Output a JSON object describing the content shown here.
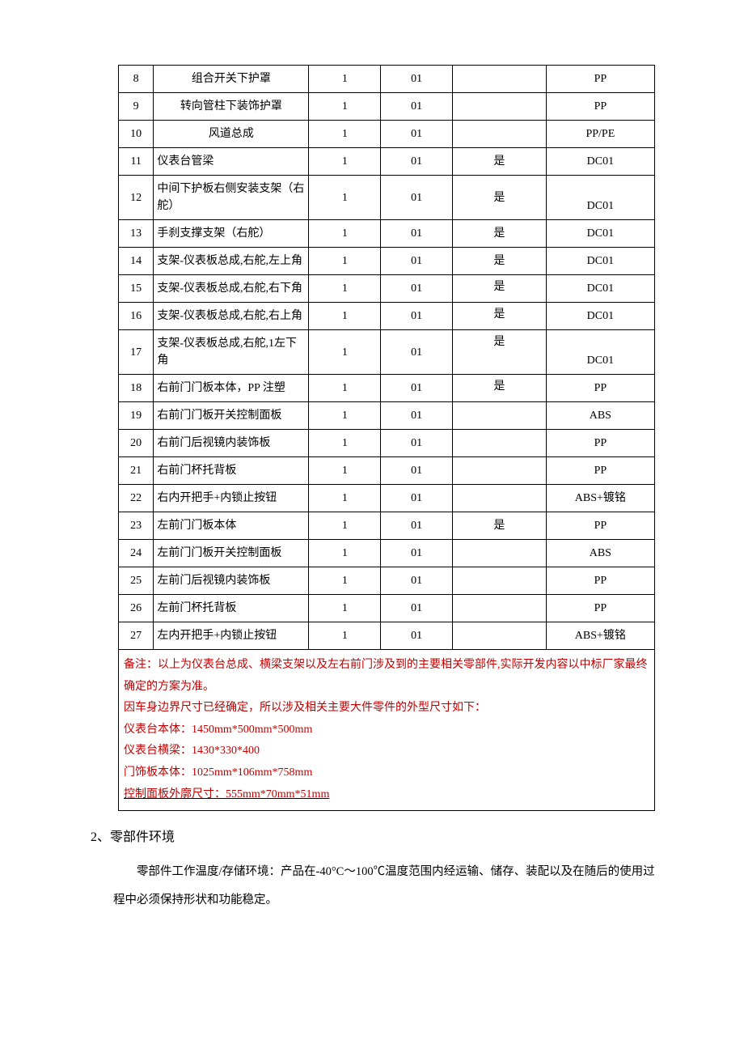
{
  "rows": [
    {
      "n": "8",
      "name": "组合开关下护罩",
      "nameClass": "center",
      "qty": "1",
      "code": "01",
      "flag": "",
      "mat": "PP"
    },
    {
      "n": "9",
      "name": "转向管柱下装饰护罩",
      "nameClass": "center",
      "qty": "1",
      "code": "01",
      "flag": "",
      "mat": "PP"
    },
    {
      "n": "10",
      "name": "风道总成",
      "nameClass": "center",
      "qty": "1",
      "code": "01",
      "flag": "",
      "mat": "PP/PE"
    },
    {
      "n": "11",
      "name": "仪表台管梁",
      "nameClass": "",
      "qty": "1",
      "code": "01",
      "flag": "是",
      "mat": "DC01"
    },
    {
      "n": "12",
      "name": "中间下护板右侧安装支架（右舵）",
      "nameClass": "",
      "qty": "1",
      "code": "01",
      "flag": "是",
      "mat": "DC01",
      "matBottom": true
    },
    {
      "n": "13",
      "name": "手刹支撑支架（右舵）",
      "nameClass": "",
      "qty": "1",
      "code": "01",
      "flag": "是",
      "mat": "DC01"
    },
    {
      "n": "14",
      "name": "支架-仪表板总成,右舵,左上角",
      "nameClass": "",
      "qty": "1",
      "code": "01",
      "flag": "是",
      "mat": "DC01",
      "matBottom": true
    },
    {
      "n": "15",
      "name": "支架-仪表板总成,右舵,右下角",
      "nameClass": "",
      "qty": "1",
      "code": "01",
      "flag": "是",
      "flagTop": true,
      "mat": "DC01",
      "matBottom": true
    },
    {
      "n": "16",
      "name": "支架-仪表板总成,右舵,右上角",
      "nameClass": "",
      "qty": "1",
      "code": "01",
      "flag": "是",
      "flagTop": true,
      "mat": "DC01",
      "matBottom": true
    },
    {
      "n": "17",
      "name": "支架-仪表板总成,右舵,1左下角",
      "nameClass": "",
      "qty": "1",
      "code": "01",
      "flag": "是",
      "flagTop": true,
      "mat": "DC01",
      "matBottom": true
    },
    {
      "n": "18",
      "name": "右前门门板本体，PP 注塑",
      "nameClass": "",
      "qty": "1",
      "code": "01",
      "flag": "是",
      "flagTop": true,
      "mat": "PP",
      "nameBottom": true,
      "matBottom": true
    },
    {
      "n": "19",
      "name": "右前门门板开关控制面板",
      "nameClass": "",
      "qty": "1",
      "code": "01",
      "flag": "",
      "mat": "ABS",
      "nameBottom": true,
      "matBottom": true
    },
    {
      "n": "20",
      "name": "右前门后视镜内装饰板",
      "nameClass": "",
      "qty": "1",
      "code": "01",
      "flag": "",
      "mat": "PP"
    },
    {
      "n": "21",
      "name": "右前门杯托背板",
      "nameClass": "",
      "qty": "1",
      "code": "01",
      "flag": "",
      "mat": "PP"
    },
    {
      "n": "22",
      "name": "右内开把手+内锁止按钮",
      "nameClass": "",
      "qty": "1",
      "code": "01",
      "flag": "",
      "mat": "ABS+镀铭",
      "nameBottom": true,
      "matBottom": true
    },
    {
      "n": "23",
      "name": "左前门门板本体",
      "nameClass": "",
      "qty": "1",
      "code": "01",
      "flag": "是",
      "mat": "PP"
    },
    {
      "n": "24",
      "name": "左前门门板开关控制面板",
      "nameClass": "",
      "qty": "1",
      "code": "01",
      "flag": "",
      "mat": "ABS",
      "nameBottom": true,
      "matBottom": true
    },
    {
      "n": "25",
      "name": "左前门后视镜内装饰板",
      "nameClass": "",
      "qty": "1",
      "code": "01",
      "flag": "",
      "mat": "PP"
    },
    {
      "n": "26",
      "name": "左前门杯托背板",
      "nameClass": "",
      "qty": "1",
      "code": "01",
      "flag": "",
      "mat": "PP"
    },
    {
      "n": "27",
      "name": "左内开把手+内锁止按钮",
      "nameClass": "",
      "qty": "1",
      "code": "01",
      "flag": "",
      "mat": "ABS+镀铭",
      "nameBottom": true,
      "matBottom": true
    }
  ],
  "note": {
    "l1": "备注：以上为仪表台总成、横梁支架以及左右前门涉及到的主要相关零部件,实际开发内容以中标厂家最终确定的方案为准。",
    "l2": "因车身边界尺寸已经确定，所以涉及相关主要大件零件的外型尺寸如下：",
    "l3": "仪表台本体：1450mm*500mm*500mm",
    "l4": "仪表台横梁：1430*330*400",
    "l5": "门饰板本体：1025mm*106mm*758mm",
    "l6": "控制面板外廓尺寸：555mm*70mm*51mm"
  },
  "section": {
    "heading": "2、零部件环境"
  },
  "body": {
    "text": "零部件工作温度/存储环境：产品在-40°C～100℃温度范围内经运输、储存、装配以及在随后的使用过程中必须保持形状和功能稳定。"
  }
}
